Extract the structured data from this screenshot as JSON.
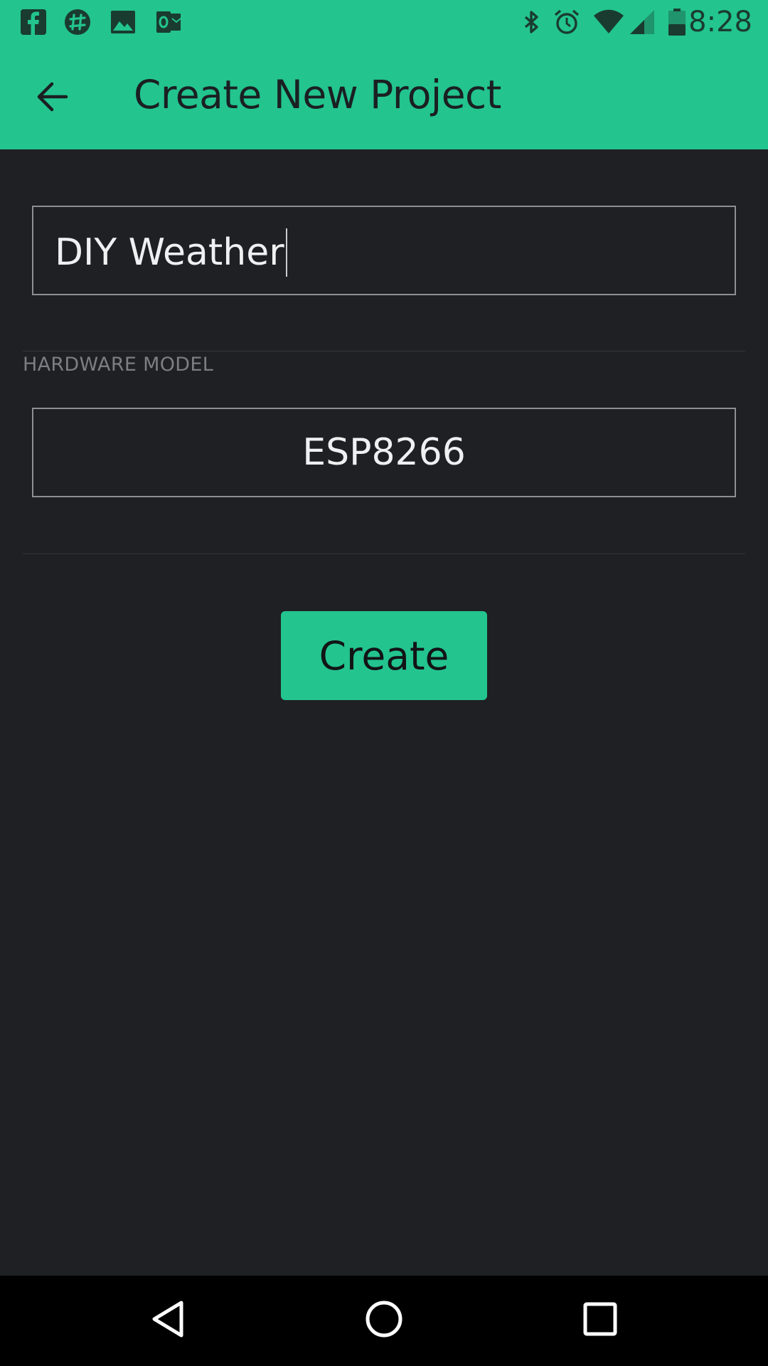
{
  "colors": {
    "accent": "#23c48e",
    "background": "#1f2024",
    "nav_bar": "#000000",
    "field_border": "#8d8f93"
  },
  "status_bar": {
    "time": "8:28",
    "left_icons": [
      "facebook-icon",
      "slack-icon",
      "gallery-icon",
      "outlook-icon"
    ],
    "right_icons": [
      "bluetooth-icon",
      "alarm-icon",
      "wifi-icon",
      "signal-icon",
      "battery-icon"
    ]
  },
  "app_bar": {
    "back_icon": "arrow-back-icon",
    "title": "Create New Project"
  },
  "form": {
    "project_name_value": "DIY Weather",
    "hardware_section_label": "HARDWARE MODEL",
    "hardware_model_value": "ESP8266",
    "create_button_label": "Create"
  },
  "nav_bar": {
    "icons": [
      "nav-back-icon",
      "nav-home-icon",
      "nav-recents-icon"
    ]
  }
}
